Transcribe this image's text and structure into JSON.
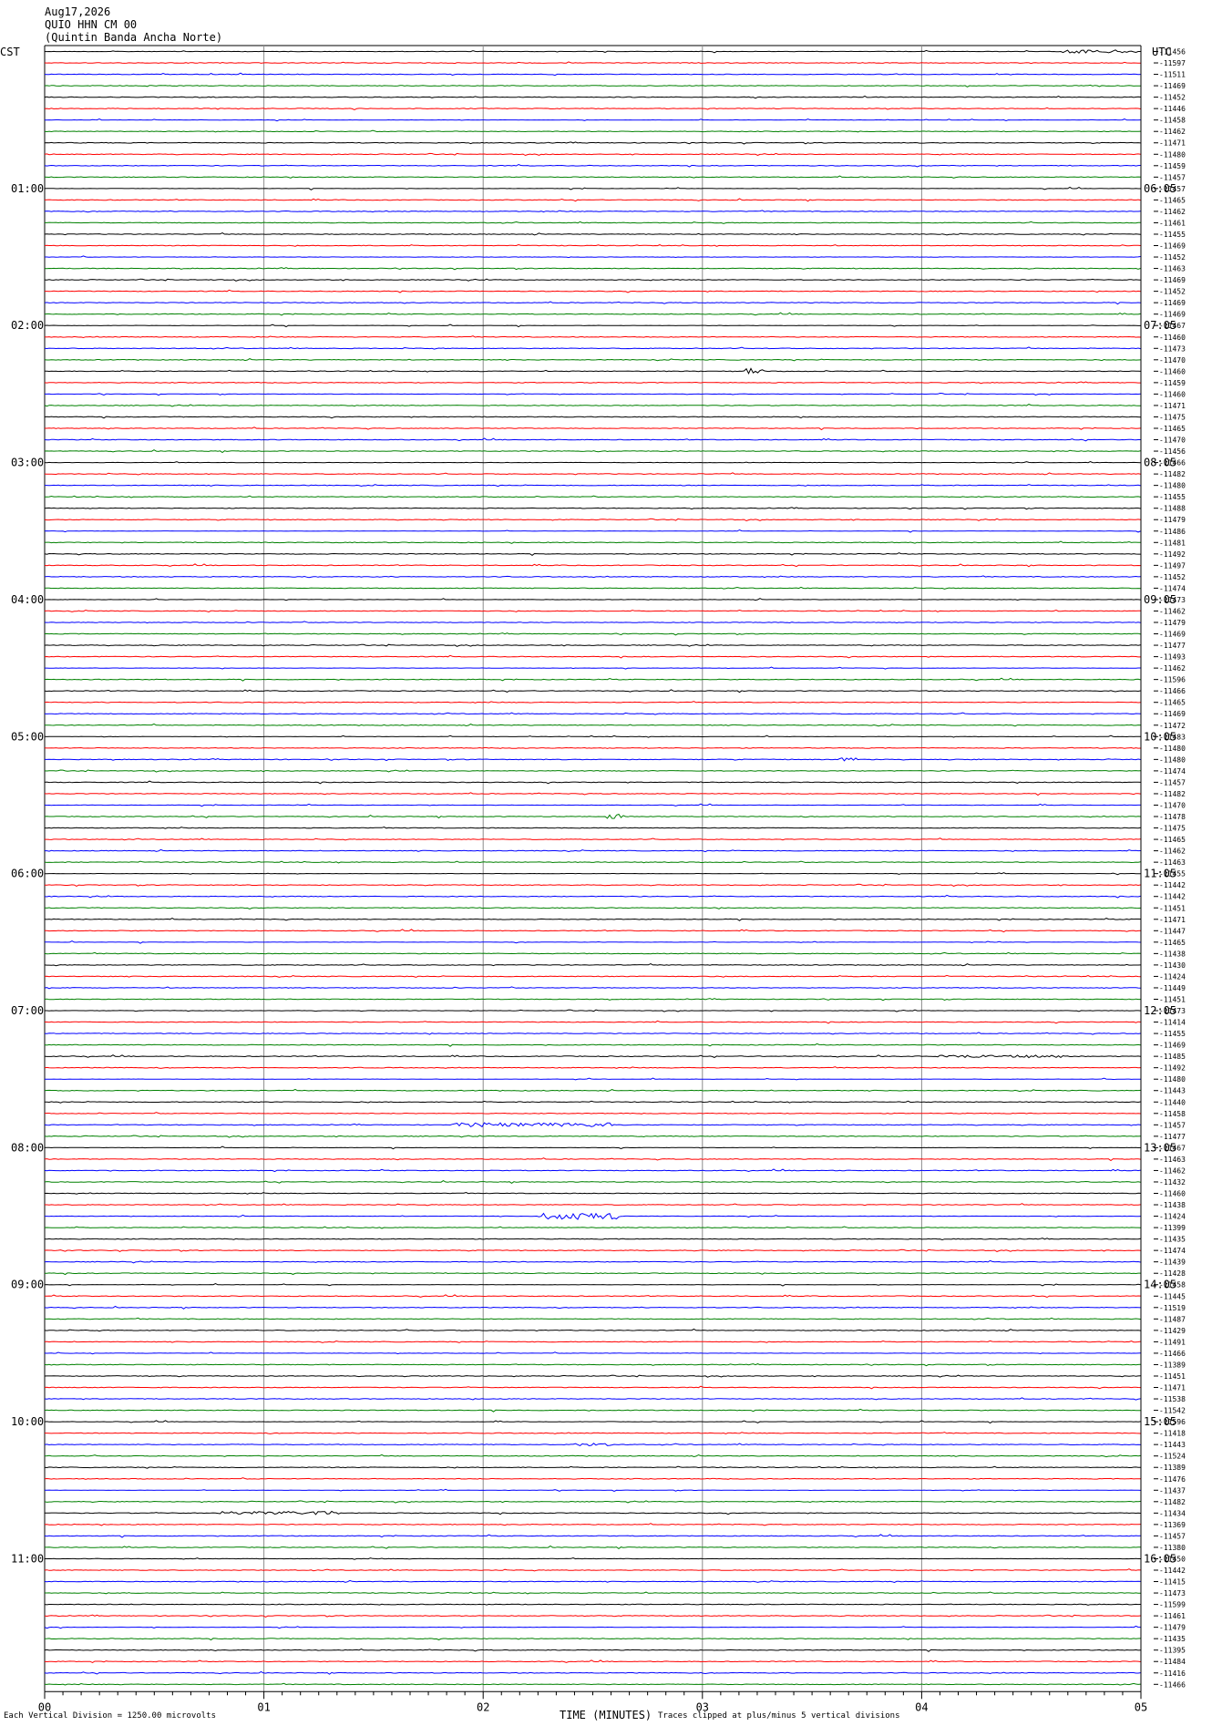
{
  "header": {
    "date": "Aug17,2026",
    "station": "QUIO HHN CM 00",
    "site": "(Quintin Banda Ancha Norte)"
  },
  "zones": {
    "left": "CST",
    "right": "UTC"
  },
  "footer": {
    "left": "Each Vertical Division = 1250.00 microvolts",
    "right": "Traces clipped at plus/minus 5 vertical divisions"
  },
  "chart_data": {
    "type": "line",
    "title": "",
    "xlabel": "TIME (MINUTES)",
    "ylabel": "",
    "x_range": [
      0,
      5
    ],
    "x_ticks": [
      "00",
      "01",
      "02",
      "03",
      "04",
      "05"
    ],
    "trace_count": 144,
    "minutes_per_trace": 5,
    "trace_colors": [
      "#000000",
      "#ff0000",
      "#0000ff",
      "#008000"
    ],
    "left_hour_labels": [
      {
        "trace": 12,
        "label": "01:00"
      },
      {
        "trace": 24,
        "label": "02:00"
      },
      {
        "trace": 36,
        "label": "03:00"
      },
      {
        "trace": 48,
        "label": "04:00"
      },
      {
        "trace": 60,
        "label": "05:00"
      },
      {
        "trace": 72,
        "label": "06:00"
      },
      {
        "trace": 84,
        "label": "07:00"
      },
      {
        "trace": 96,
        "label": "08:00"
      },
      {
        "trace": 108,
        "label": "09:00"
      },
      {
        "trace": 120,
        "label": "10:00"
      },
      {
        "trace": 132,
        "label": "11:00"
      }
    ],
    "right_hour_labels": [
      {
        "trace": 12,
        "label": "06:05"
      },
      {
        "trace": 24,
        "label": "07:05"
      },
      {
        "trace": 36,
        "label": "08:05"
      },
      {
        "trace": 48,
        "label": "09:05"
      },
      {
        "trace": 60,
        "label": "10:05"
      },
      {
        "trace": 72,
        "label": "11:05"
      },
      {
        "trace": 84,
        "label": "12:05"
      },
      {
        "trace": 96,
        "label": "13:05"
      },
      {
        "trace": 108,
        "label": "14:05"
      },
      {
        "trace": 120,
        "label": "15:05"
      },
      {
        "trace": 132,
        "label": "16:05"
      }
    ],
    "trace_offsets": [
      "-11456",
      "-11597",
      "-11511",
      "-11469",
      "-11452",
      "-11446",
      "-11458",
      "-11462",
      "-11471",
      "-11480",
      "-11459",
      "-11457",
      "-11457",
      "-11465",
      "-11462",
      "-11461",
      "-11455",
      "-11469",
      "-11452",
      "-11463",
      "-11469",
      "-11452",
      "-11469",
      "-11469",
      "-11467",
      "-11460",
      "-11473",
      "-11470",
      "-11460",
      "-11459",
      "-11460",
      "-11471",
      "-11475",
      "-11465",
      "-11470",
      "-11456",
      "-11466",
      "-11482",
      "-11480",
      "-11455",
      "-11488",
      "-11479",
      "-11486",
      "-11481",
      "-11492",
      "-11497",
      "-11452",
      "-11474",
      "-11473",
      "-11462",
      "-11479",
      "-11469",
      "-11477",
      "-11493",
      "-11462",
      "-11596",
      "-11466",
      "-11465",
      "-11469",
      "-11472",
      "-11483",
      "-11480",
      "-11480",
      "-11474",
      "-11457",
      "-11482",
      "-11470",
      "-11478",
      "-11475",
      "-11465",
      "-11462",
      "-11463",
      "-11455",
      "-11442",
      "-11442",
      "-11451",
      "-11471",
      "-11447",
      "-11465",
      "-11438",
      "-11430",
      "-11424",
      "-11449",
      "-11451",
      "-11473",
      "-11414",
      "-11455",
      "-11469",
      "-11485",
      "-11492",
      "-11480",
      "-11443",
      "-11440",
      "-11458",
      "-11457",
      "-11477",
      "-11467",
      "-11463",
      "-11462",
      "-11432",
      "-11460",
      "-11438",
      "-11424",
      "-11399",
      "-11435",
      "-11474",
      "-11439",
      "-11428",
      "-11458",
      "-11445",
      "-11519",
      "-11487",
      "-11429",
      "-11491",
      "-11466",
      "-11389",
      "-11451",
      "-11471",
      "-11538",
      "-11542",
      "-11596",
      "-11418",
      "-11443",
      "-11524",
      "-11389",
      "-11476",
      "-11437",
      "-11482",
      "-11434",
      "-11369",
      "-11457",
      "-11380",
      "-11450",
      "-11442",
      "-11415",
      "-11473",
      "-11599",
      "-11461",
      "-11479",
      "-11435",
      "-11395",
      "-11484",
      "-11416",
      "-11466"
    ],
    "events": [
      {
        "trace": 0,
        "t_start": 4.64,
        "t_end": 4.98,
        "amplitude": 0.5
      },
      {
        "trace": 28,
        "t_start": 3.2,
        "t_end": 3.28,
        "amplitude": 0.9
      },
      {
        "trace": 62,
        "t_start": 3.62,
        "t_end": 3.7,
        "amplitude": 0.7
      },
      {
        "trace": 67,
        "t_start": 2.56,
        "t_end": 2.64,
        "amplitude": 0.8
      },
      {
        "trace": 94,
        "t_start": 1.85,
        "t_end": 2.6,
        "amplitude": 0.6
      },
      {
        "trace": 102,
        "t_start": 2.25,
        "t_end": 2.62,
        "amplitude": 1.0
      },
      {
        "trace": 88,
        "t_start": 4.05,
        "t_end": 4.65,
        "amplitude": 0.4
      },
      {
        "trace": 128,
        "t_start": 0.8,
        "t_end": 1.35,
        "amplitude": 0.5
      },
      {
        "trace": 122,
        "t_start": 2.4,
        "t_end": 2.6,
        "amplitude": 0.4
      }
    ]
  }
}
